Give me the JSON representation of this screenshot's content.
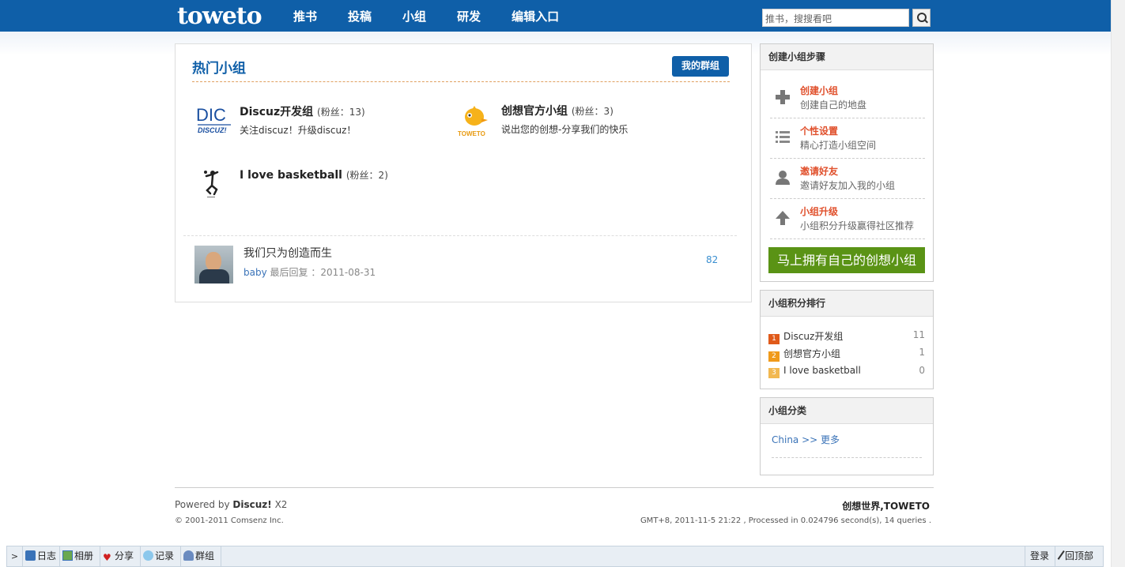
{
  "header": {
    "logo": "toweto",
    "nav": [
      "推书",
      "投稿",
      "小组",
      "研发",
      "编辑入口"
    ],
    "search_placeholder": "推书，搜搜看吧"
  },
  "hot_groups": {
    "title": "热门小组",
    "my_groups_button": "我的群组",
    "groups": [
      {
        "name": "Discuz开发组",
        "fans": "(粉丝：13)",
        "desc": "关注discuz！升级discuz！",
        "icon_text": "DIC",
        "icon_sub": "DISCUZ!"
      },
      {
        "name": "创想官方小组",
        "fans": "(粉丝：3)",
        "desc": "说出您的创想-分享我们的快乐",
        "icon_text": "TOWETO"
      },
      {
        "name": "I love basketball",
        "fans": "(粉丝：2)",
        "desc": ""
      }
    ],
    "post": {
      "title": "我们只为创造而生",
      "user": "baby",
      "meta": "最后回复 ：2011-08-31",
      "count": "82"
    }
  },
  "sidebar": {
    "steps_title": "创建小组步骤",
    "steps": [
      {
        "title": "创建小组",
        "desc": "创建自己的地盘",
        "icon": "plus-icon"
      },
      {
        "title": "个性设置",
        "desc": "精心打造小组空间",
        "icon": "list-icon"
      },
      {
        "title": "邀请好友",
        "desc": "邀请好友加入我的小组",
        "icon": "user-icon"
      },
      {
        "title": "小组升级",
        "desc": "小组积分升级赢得社区推荐",
        "icon": "arrow-up-icon"
      }
    ],
    "create_button": "马上拥有自己的创想小组",
    "rank_title": "小组积分排行",
    "ranks": [
      {
        "num": "1",
        "name": "Discuz开发组",
        "score": "11",
        "color": "#e05a1a"
      },
      {
        "num": "2",
        "name": "创想官方小组",
        "score": "1",
        "color": "#f09a1a"
      },
      {
        "num": "3",
        "name": "I love basketball",
        "score": "0",
        "color": "#f2b850"
      }
    ],
    "category_title": "小组分类",
    "category_link": "China >> 更多"
  },
  "footer": {
    "powered_prefix": "Powered by",
    "powered_brand": "Discuz!",
    "powered_version": "X2",
    "copyright": "© 2001-2011 Comsenz Inc.",
    "slogan": "创想世界,TOWETO",
    "processed": "GMT+8, 2011-11-5 21:22 , Processed in 0.024796 second(s), 14 queries ."
  },
  "toolbar": {
    "toggle": ">",
    "items": [
      "日志",
      "相册",
      "分享",
      "记录",
      "群组"
    ],
    "login": "登录",
    "back_top": "回顶部"
  }
}
